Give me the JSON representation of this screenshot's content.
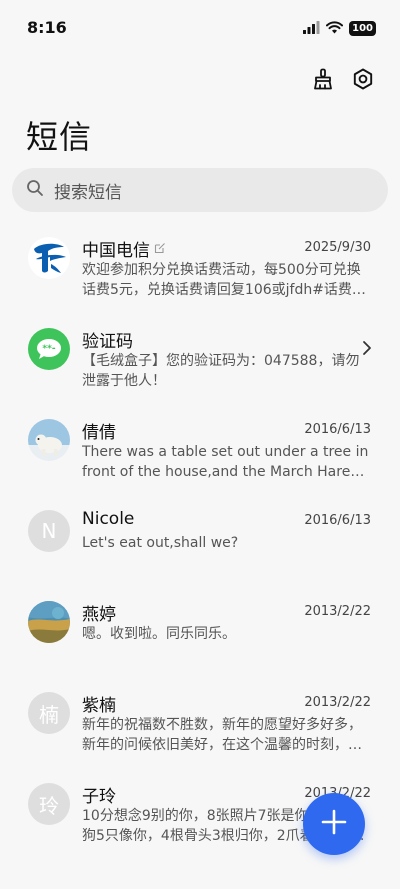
{
  "status_bar": {
    "time": "8:16",
    "battery": "100",
    "signal_icon": "signal-icon",
    "wifi_icon": "wifi-icon"
  },
  "toolbar": {
    "clean_icon": "broom-icon",
    "settings_icon": "gear-icon"
  },
  "page": {
    "title": "短信"
  },
  "search": {
    "placeholder": "搜索短信"
  },
  "messages": [
    {
      "name": "中国电信",
      "date": "2025/9/30",
      "preview": "欢迎参加积分兑换话费活动，每500分可兑换话费5元，兑换话费请回复106或jfdh#话费…",
      "avatar": "china-telecom-logo",
      "badge_icon": "edit-icon"
    },
    {
      "name": "验证码",
      "date": "",
      "preview": "【毛绒盒子】您的验证码为：047588，请勿泄露于他人！",
      "avatar": "verification-code-icon",
      "accent_color": "#3ec45a"
    },
    {
      "name": "倩倩",
      "date": "2016/6/13",
      "preview": "There was a table set out under a tree in front of the house,and the March Hare an…",
      "avatar": "polar-bear-photo"
    },
    {
      "name": "Nicole",
      "date": "2016/6/13",
      "preview": "Let's eat out,shall we?",
      "avatar_letter": "N"
    },
    {
      "name": "燕婷",
      "date": "2013/2/22",
      "preview": "嗯。收到啦。同乐同乐。",
      "avatar": "landscape-photo"
    },
    {
      "name": "紫楠",
      "date": "2013/2/22",
      "preview": "新年的祝福数不胜数，新年的愿望好多好多，新年的问候依旧美好，在这个温馨的时刻，…",
      "avatar_letter": "楠"
    },
    {
      "name": "子玲",
      "date": "2013/2/22",
      "preview": "10分想念9别的你，8张照片7张是你，6只小狗5只像你，4根骨头3根归你，2爪着地1宗…",
      "avatar_letter": "玲"
    }
  ],
  "fab": {
    "icon": "plus-icon",
    "color": "#2e69f0"
  }
}
